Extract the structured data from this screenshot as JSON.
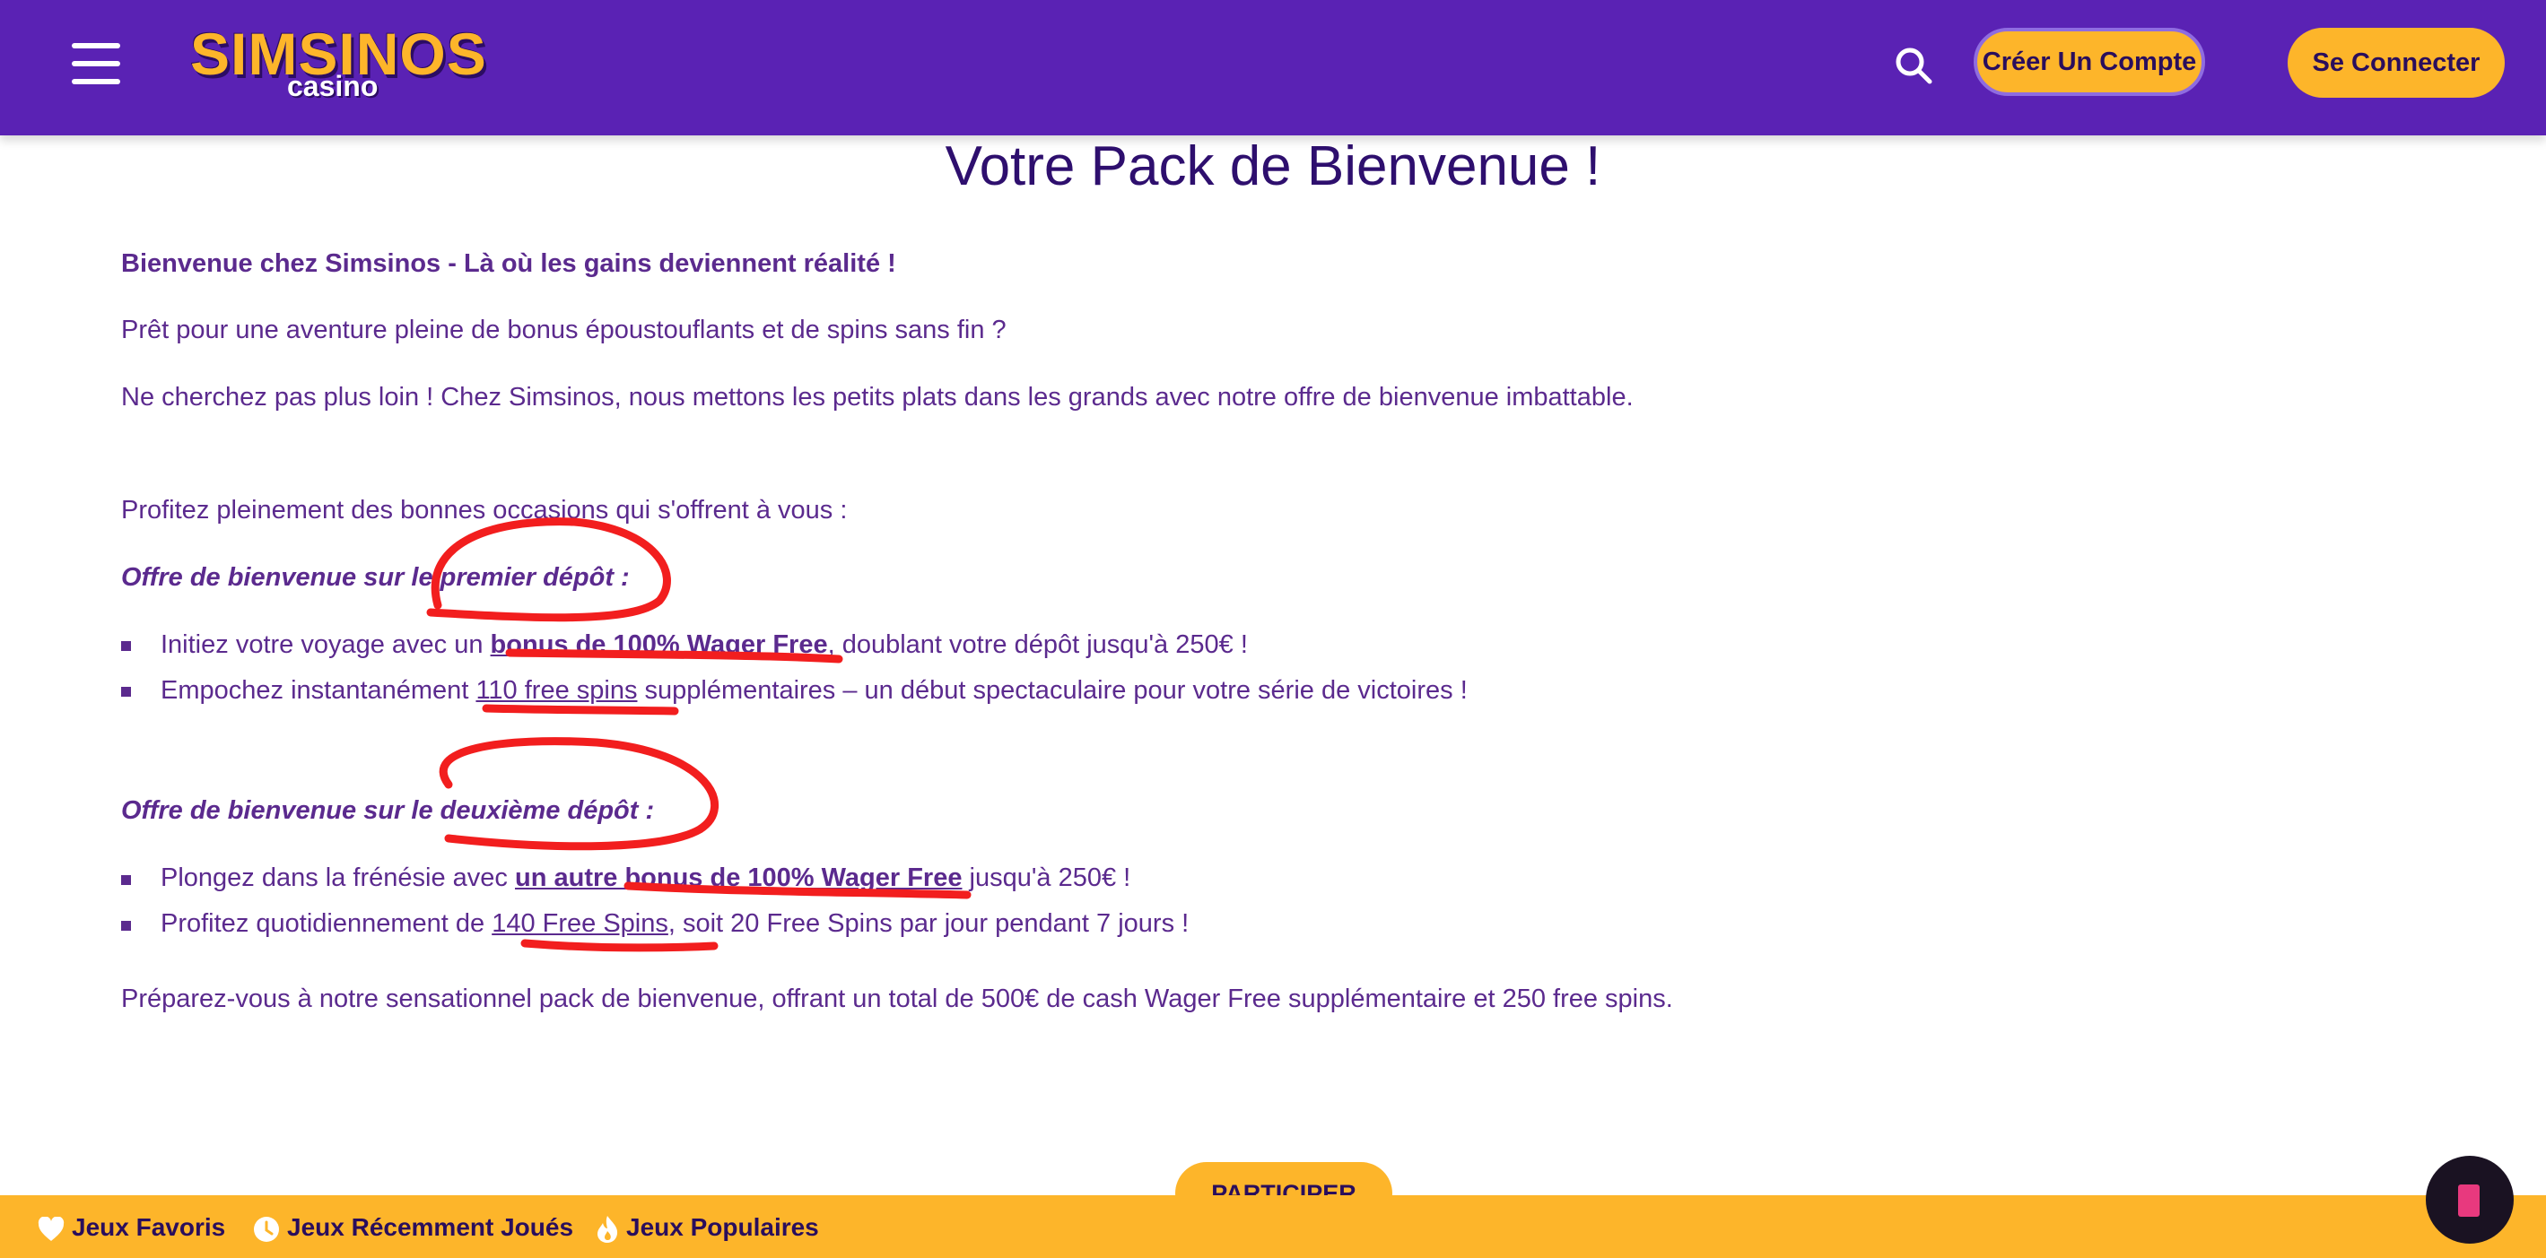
{
  "header": {
    "logo_main": "SIMSINOS",
    "logo_sub": "casino",
    "create_account": "Créer Un Compte",
    "login": "Se Connecter"
  },
  "main": {
    "title": "Votre Pack de Bienvenue !",
    "intro_bold": "Bienvenue chez Simsinos - Là où les gains deviennent réalité !",
    "p1": "Prêt pour une aventure pleine de bonus époustouflants et de spins sans fin ?",
    "p2": "Ne cherchez pas plus loin ! Chez Simsinos, nous mettons les petits plats dans les grands avec notre offre de bienvenue imbattable.",
    "p3": "Profitez pleinement des bonnes occasions qui s'offrent à vous :",
    "offer1_heading": "Offre de bienvenue sur le premier dépôt :",
    "offer1_items": [
      {
        "pre": "Initiez votre voyage avec un ",
        "hl": "bonus de 100% Wager Free",
        "post": ", doublant votre dépôt jusqu'à 250€ !"
      },
      {
        "pre": "Empochez instantanément ",
        "hl": "110 free spins",
        "post": " supplémentaires – un début spectaculaire pour votre série de victoires !"
      }
    ],
    "offer2_heading": "Offre de bienvenue sur le deuxième dépôt :",
    "offer2_items": [
      {
        "pre": "Plongez dans la frénésie avec ",
        "hl": "un autre bonus de 100% Wager Free",
        "post": " jusqu'à 250€ !"
      },
      {
        "pre": "Profitez quotidiennement de ",
        "hl": "140 Free Spins",
        "post": ", soit 20 Free Spins par jour pendant 7 jours !"
      }
    ],
    "closing": "Préparez-vous à notre sensationnel pack de bienvenue, offrant un total de 500€ de cash Wager Free supplémentaire et 250 free spins.",
    "participate": "PARTICIPER"
  },
  "footer": {
    "favorites": "Jeux Favoris",
    "recent": "Jeux Récemment Joués",
    "popular": "Jeux Populaires"
  },
  "icons": [
    "menu-icon",
    "search-icon",
    "heart-icon",
    "clock-icon",
    "flame-icon",
    "chat-icon"
  ]
}
